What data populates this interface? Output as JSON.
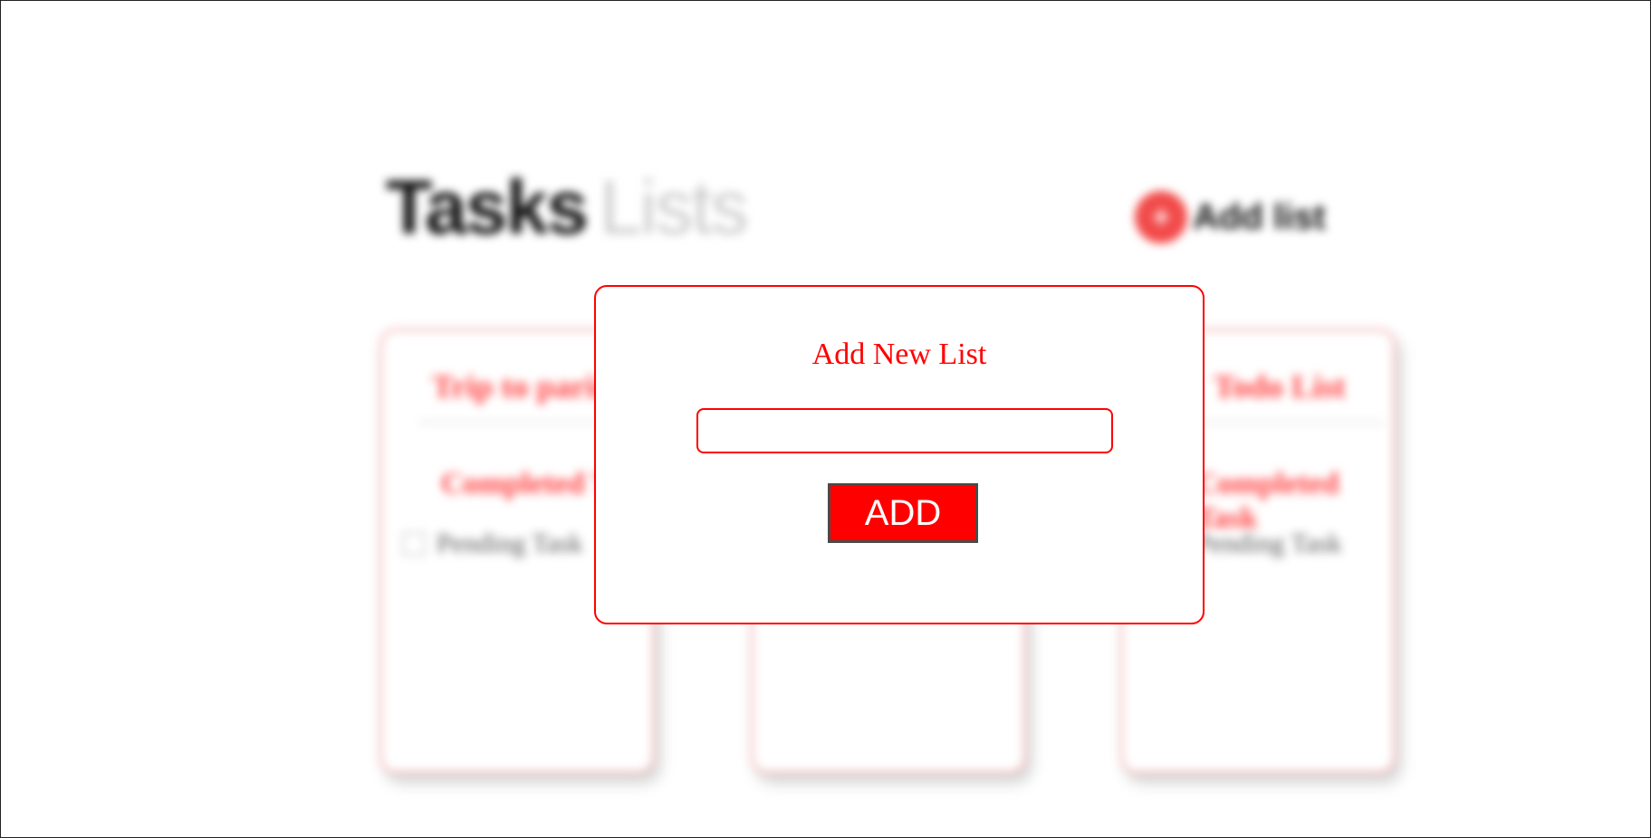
{
  "header": {
    "title_bold": "Tasks",
    "title_light": "Lists",
    "add_list_icon": "plus-icon",
    "add_list_label": "Add list"
  },
  "lists": [
    {
      "title": "Trip to paris",
      "completed_label": "Completed T",
      "task": "Pending Task"
    },
    {
      "title": "",
      "completed_label": "",
      "task": ""
    },
    {
      "title": "Todo List",
      "completed_label": "Completed Task",
      "task": "Pending Task"
    }
  ],
  "modal": {
    "title": "Add New List",
    "input_value": "",
    "input_placeholder": "",
    "add_button_label": "ADD"
  },
  "colors": {
    "accent": "#ff0000",
    "button_border": "#4a4a4a",
    "plus_circle": "#f24a4a",
    "card_border": "#f6b5b5"
  }
}
